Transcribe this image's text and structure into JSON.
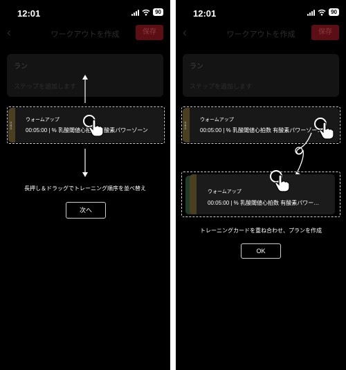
{
  "status": {
    "time": "12:01",
    "battery": "90"
  },
  "header": {
    "title": "ワークアウトを作成",
    "save_label": "保存"
  },
  "workout": {
    "run_title": "ラン",
    "run_sub": "ステップを追加します"
  },
  "card": {
    "title": "ウォームアップ",
    "detail_full": "00:05:00 | % 乳酸閾値心拍数 有酸素パワーゾーン",
    "detail_short": "00:05:00 | % 乳酸閾値心拍数 有酸素パワー…"
  },
  "left_panel": {
    "hint": "長押し＆ドラッグでトレーニング順序を並べ替え",
    "next_label": "次へ"
  },
  "right_panel": {
    "hint": "トレーニングカードを重ね合わせ、プランを作成",
    "ok_label": "OK"
  },
  "colors": {
    "background": "#000000",
    "save_button": "#5b0f15",
    "card_strip": "#4a3f1f",
    "card_strip_green": "#1f3d2a"
  },
  "icons": [
    "back-chevron-icon",
    "signal-icon",
    "wifi-icon",
    "battery-icon",
    "drag-grip-icon",
    "tap-hand-icon",
    "arrow-up-icon",
    "arrow-down-icon",
    "curved-arrow-icon"
  ]
}
